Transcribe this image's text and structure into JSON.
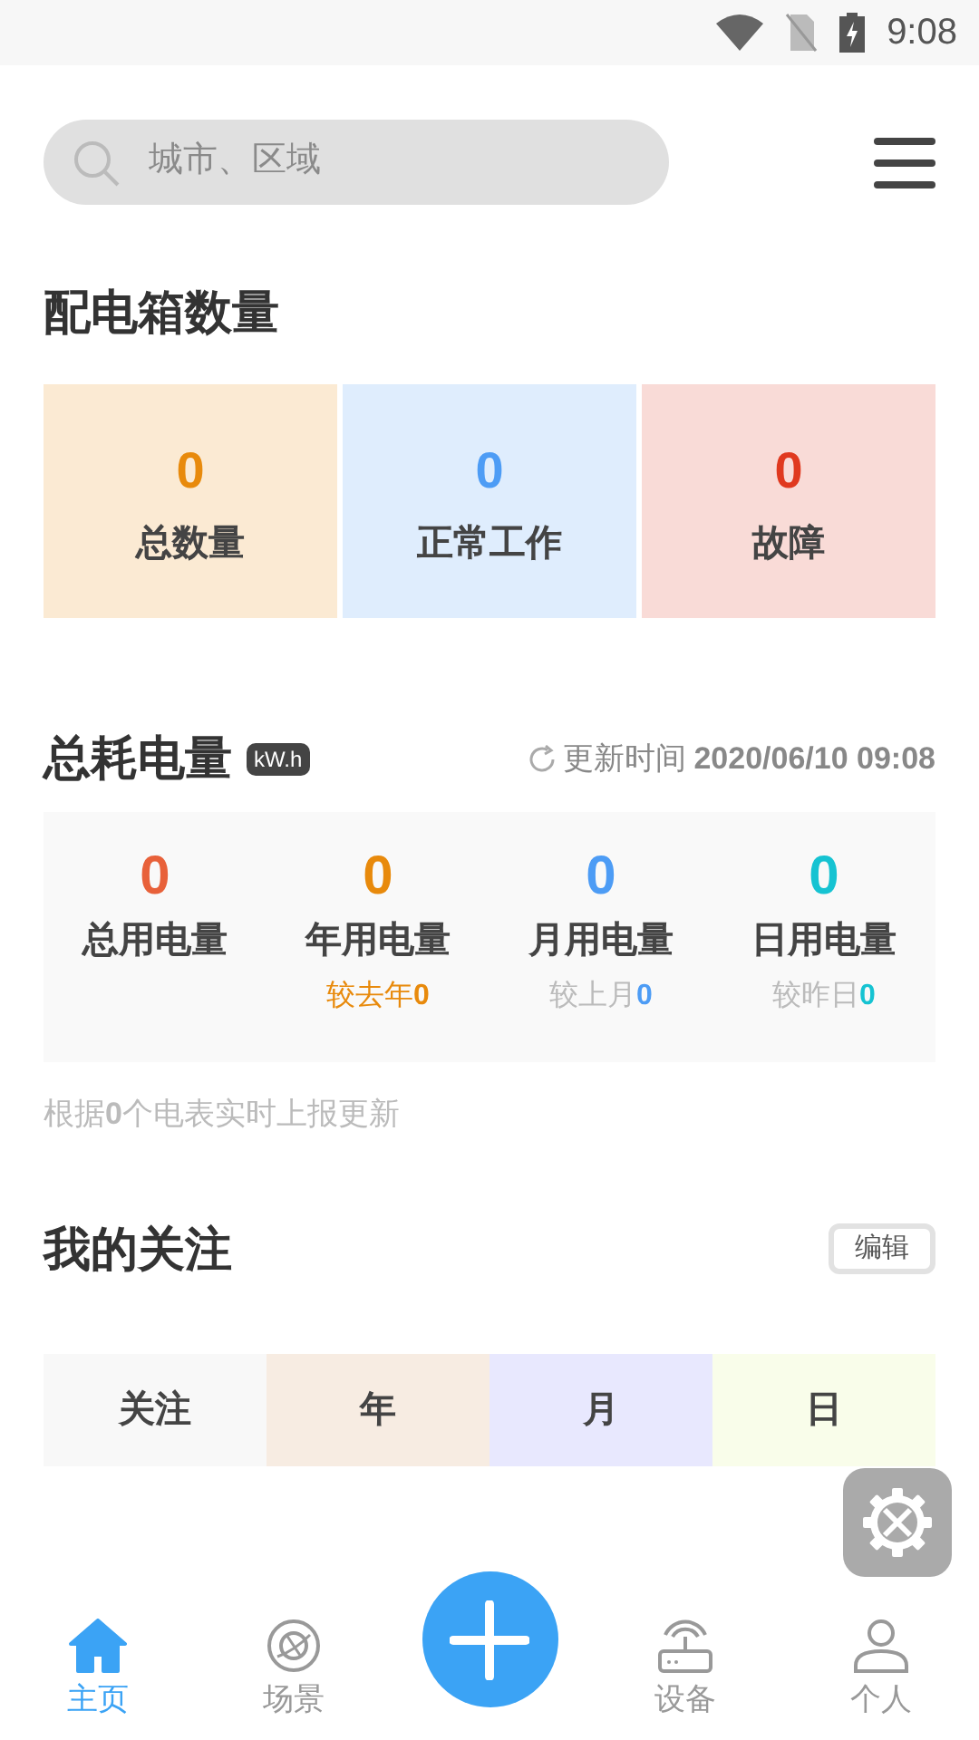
{
  "status_bar": {
    "time": "9:08"
  },
  "search": {
    "placeholder": "城市、区域"
  },
  "box_section": {
    "title": "配电箱数量",
    "stats": [
      {
        "value": "0",
        "label": "总数量",
        "color": "#e88a0c"
      },
      {
        "value": "0",
        "label": "正常工作",
        "color": "#4d9cf5"
      },
      {
        "value": "0",
        "label": "故障",
        "color": "#e0391f"
      }
    ]
  },
  "energy": {
    "title": "总耗电量",
    "unit": "kW.h",
    "update_label": "更新时间",
    "update_time": "2020/06/10 09:08",
    "stats": [
      {
        "value": "0",
        "label": "总用电量",
        "color": "#e8613a"
      },
      {
        "value": "0",
        "label": "年用电量",
        "color": "#e88a0c",
        "compare": {
          "label": "较去年",
          "value": "0",
          "highlighted": true
        }
      },
      {
        "value": "0",
        "label": "月用电量",
        "color": "#4d9cf5",
        "compare": {
          "label": "较上月",
          "value": "0",
          "highlighted": false
        }
      },
      {
        "value": "0",
        "label": "日用电量",
        "color": "#16c3d2",
        "compare": {
          "label": "较昨日",
          "value": "0",
          "highlighted": false
        }
      }
    ],
    "footnote": "根据**0**个电表实时上报更新"
  },
  "follow": {
    "title": "我的关注",
    "edit_button": "编辑",
    "columns": [
      {
        "label": "关注",
        "color": "#f8f8f8"
      },
      {
        "label": "年",
        "color": "#f7ece2"
      },
      {
        "label": "月",
        "color": "#e8e8fe"
      },
      {
        "label": "日",
        "color": "#f9fdea"
      }
    ]
  },
  "nav": {
    "items": [
      {
        "label": "主页",
        "selected": true
      },
      {
        "label": "场景",
        "selected": false
      },
      {
        "label": "设备",
        "selected": false
      },
      {
        "label": "个人",
        "selected": false
      }
    ]
  }
}
